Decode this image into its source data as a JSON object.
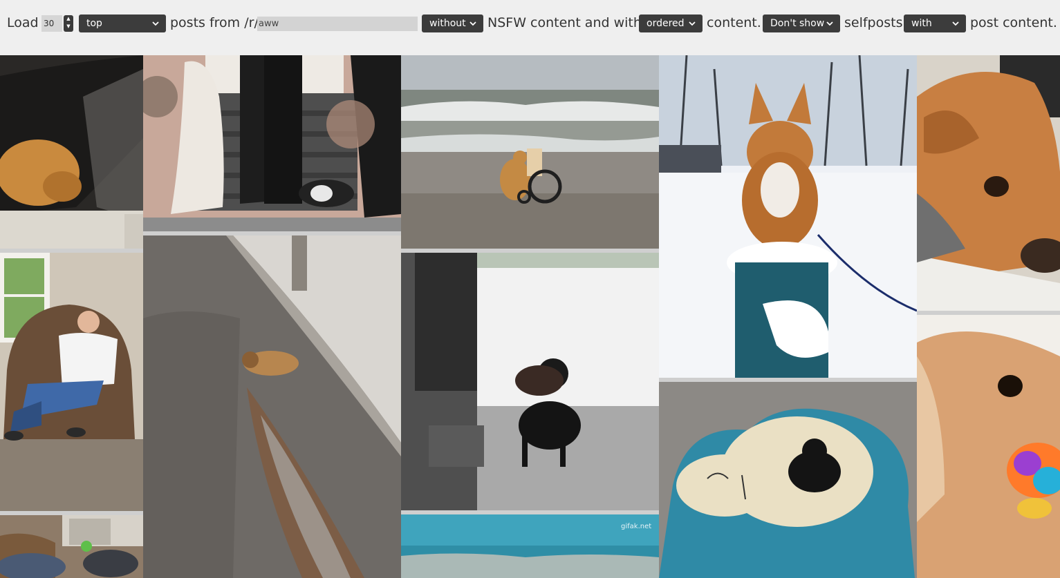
{
  "controls": {
    "load_label": "Load",
    "count_value": "30",
    "sort_selected": "top",
    "posts_from_label": "posts from /r/",
    "subreddit_value": "aww",
    "nsfw_selected": "without",
    "nsfw_label": "NSFW content and with",
    "order_selected": "ordered",
    "content_label": "content.",
    "selfposts_selected": "Don't show",
    "selfposts_label": "selfposts",
    "postcontent_selected": "with",
    "postcontent_label": "post content."
  },
  "gallery": {
    "watermark": "gifak.net"
  }
}
